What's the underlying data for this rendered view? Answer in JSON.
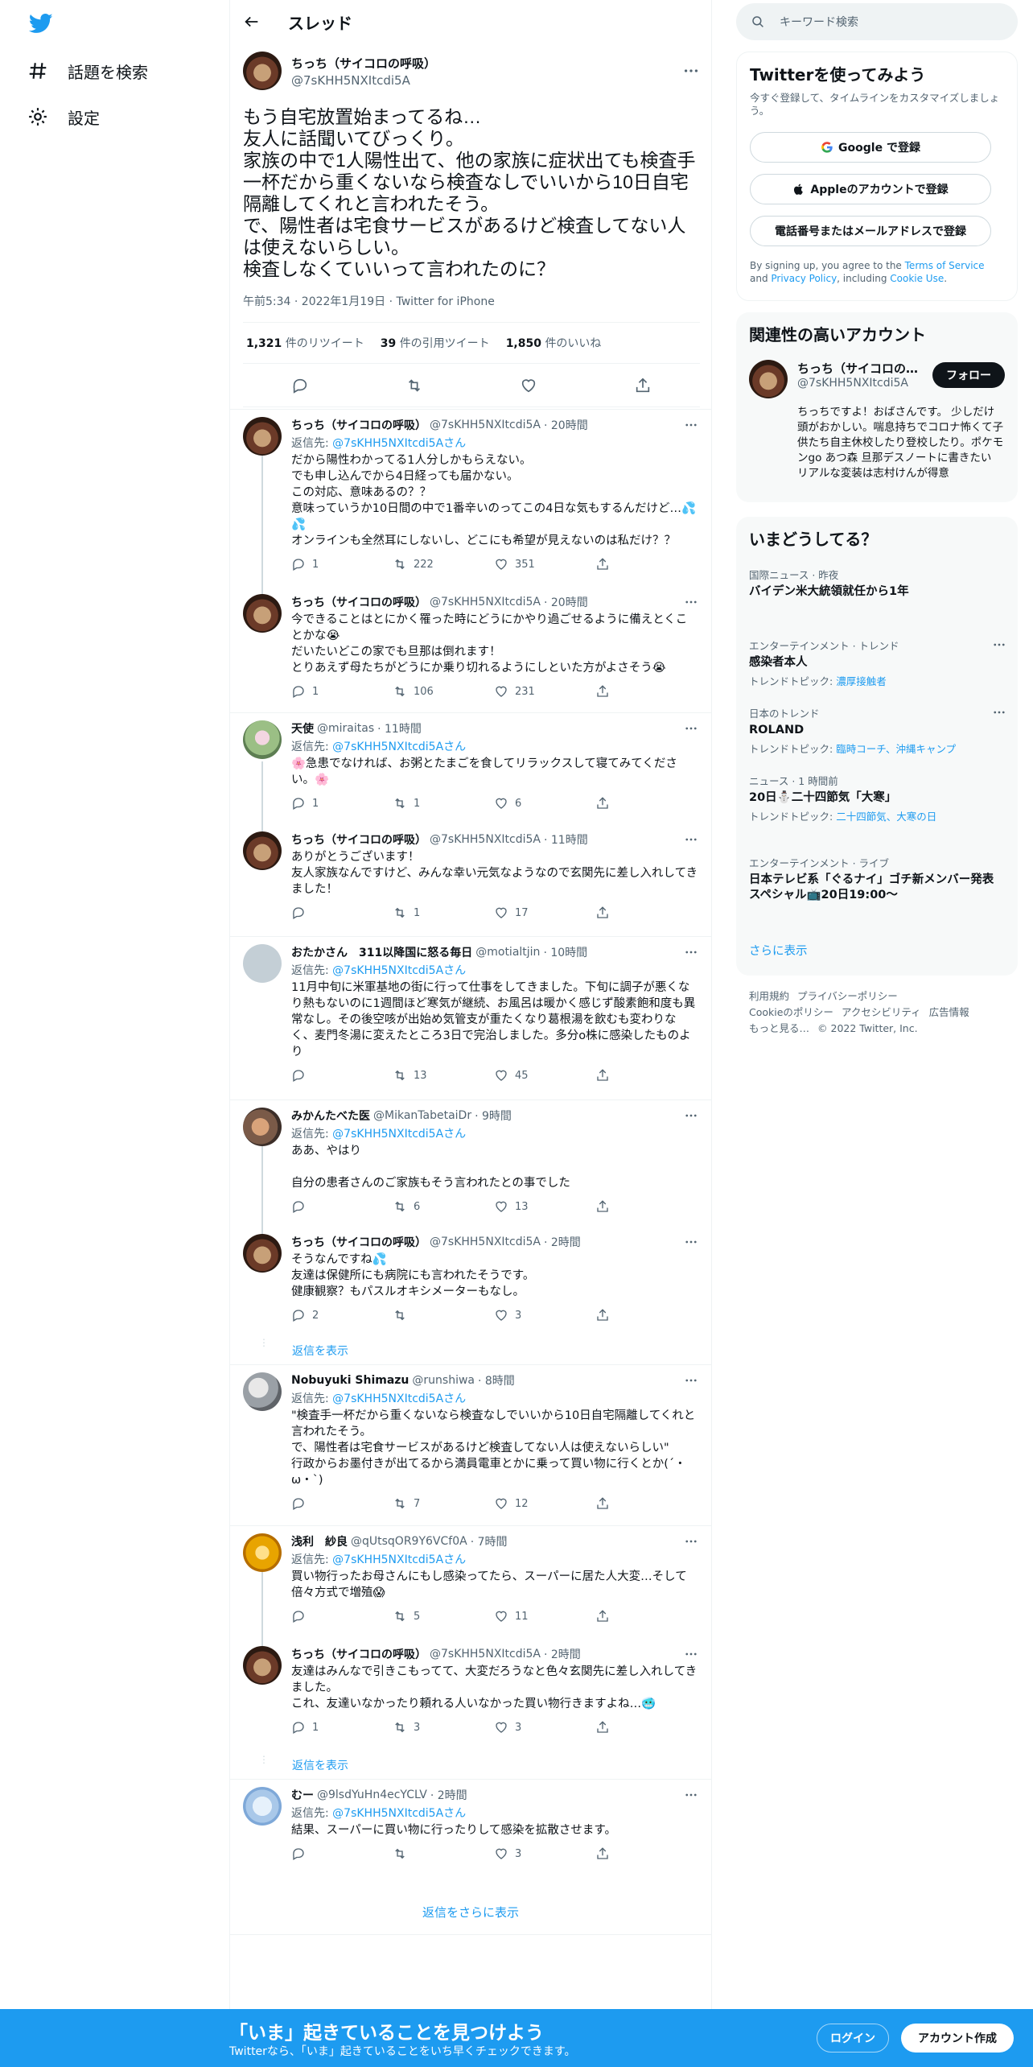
{
  "nav": {
    "explore_label": "話題を検索",
    "settings_label": "設定"
  },
  "header": {
    "title": "スレッド"
  },
  "focal": {
    "name": "ちっち（サイコロの呼吸）",
    "handle": "@7sKHH5NXItcdi5A",
    "text": "もう自宅放置始まってるね…\n友人に話聞いてびっくり。\n家族の中で1人陽性出て、他の家族に症状出ても検査手一杯だから重くないなら検査なしでいいから10日自宅隔離してくれと言われたそう。\nで、陽性者は宅食サービスがあるけど検査してない人は使えないらしい。\n検査しなくていいって言われたのに？",
    "meta": "午前5:34 · 2022年1月19日 · Twitter for iPhone",
    "retweets_count": "1,321",
    "retweets_label": "件のリツイート",
    "quotes_count": "39",
    "quotes_label": "件の引用ツイート",
    "likes_count": "1,850",
    "likes_label": "件のいいね"
  },
  "replies": [
    {
      "name": "ちっち（サイコロの呼吸）",
      "handle": "@7sKHH5NXItcdi5A",
      "time": "· 20時間",
      "reply_to": "@7sKHH5NXItcdi5A",
      "text": "だから陽性わかってる1人分しかもらえない。\nでも申し込んでから4日経っても届かない。\nこの対応、意味あるの？？\n意味っていうか10日間の中で1番辛いのってこの4日な気もするんだけど…💦💦\nオンラインも全然耳にしないし、どこにも希望が見えないのは私だけ？？",
      "replies": "1",
      "retweets": "222",
      "likes": "351"
    },
    {
      "name": "ちっち（サイコロの呼吸）",
      "handle": "@7sKHH5NXItcdi5A",
      "time": "· 20時間",
      "reply_to": "",
      "text": "今できることはとにかく罹った時にどうにかやり過ごせるように備えとくことかな😭\nだいたいどこの家でも旦那は倒れます！\nとりあえず母たちがどうにか乗り切れるようにしといた方がよさそう😭",
      "replies": "1",
      "retweets": "106",
      "likes": "231"
    },
    {
      "name": "天使",
      "handle": "@miraitas",
      "time": "· 11時間",
      "reply_to": "@7sKHH5NXItcdi5A",
      "text": "🌸急患でなければ、お粥とたまごを食してリラックスして寝てみてください。🌸",
      "replies": "1",
      "retweets": "1",
      "likes": "6"
    },
    {
      "name": "ちっち（サイコロの呼吸）",
      "handle": "@7sKHH5NXItcdi5A",
      "time": "· 11時間",
      "reply_to": "",
      "text": "ありがとうございます！\n友人家族なんですけど、みんな幸い元気なようなので玄関先に差し入れしてきました！",
      "replies": "",
      "retweets": "1",
      "likes": "17"
    },
    {
      "name": "おたかさん　311以降国に怒る毎日",
      "handle": "@motialtjin",
      "time": "· 10時間",
      "reply_to": "@7sKHH5NXItcdi5A",
      "text": "11月中旬に米軍基地の街に行って仕事をしてきました。下旬に調子が悪くなり熱もないのに1週間ほど寒気が継続、お風呂は暖かく感じず酸素飽和度も異常なし。その後空咳が出始め気管支が重たくなり葛根湯を飲むも変わりなく、麦門冬湯に変えたところ3日で完治しました。多分o株に感染したものより",
      "replies": "",
      "retweets": "13",
      "likes": "45"
    },
    {
      "name": "みかんたべた医",
      "handle": "@MikanTabetaiDr",
      "time": "· 9時間",
      "reply_to": "@7sKHH5NXItcdi5A",
      "text": "ああ、やはり\n\n自分の患者さんのご家族もそう言われたとの事でした",
      "replies": "",
      "retweets": "6",
      "likes": "13"
    },
    {
      "name": "ちっち（サイコロの呼吸）",
      "handle": "@7sKHH5NXItcdi5A",
      "time": "· 2時間",
      "reply_to": "",
      "text": "そうなんですね💦\n友達は保健所にも病院にも言われたそうです。\n健康観察？もパスルオキシメーターもなし。",
      "replies": "2",
      "retweets": "",
      "likes": "3"
    },
    {
      "name": "Nobuyuki Shimazu",
      "handle": "@runshiwa",
      "time": "· 8時間",
      "reply_to": "@7sKHH5NXItcdi5A",
      "text": "\"検査手一杯だから重くないなら検査なしでいいから10日自宅隔離してくれと言われたそう。\nで、陽性者は宅食サービスがあるけど検査してない人は使えないらしい\"\n行政からお墨付きが出てるから満員電車とかに乗って買い物に行くとか(´・ω・`)",
      "replies": "",
      "retweets": "7",
      "likes": "12"
    },
    {
      "name": "浅利　紗良",
      "handle": "@qUtsqOR9Y6VCf0A",
      "time": "· 7時間",
      "reply_to": "@7sKHH5NXItcdi5A",
      "text": "買い物行ったお母さんにもし感染ってたら、スーパーに居た人大変…そして倍々方式で増殖😱",
      "replies": "",
      "retweets": "5",
      "likes": "11"
    },
    {
      "name": "ちっち（サイコロの呼吸）",
      "handle": "@7sKHH5NXItcdi5A",
      "time": "· 2時間",
      "reply_to": "",
      "text": "友達はみんなで引きこもってて、大変だろうなと色々玄関先に差し入れしてきました。\nこれ、友達いなかったり頼れる人いなかった買い物行きますよね…🥶",
      "replies": "1",
      "retweets": "3",
      "likes": "3"
    },
    {
      "name": "むー",
      "handle": "@9lsdYuHn4ecYCLV",
      "time": "· 2時間",
      "reply_to": "@7sKHH5NXItcdi5A",
      "text": "結果、スーパーに買い物に行ったりして感染を拡散させます。",
      "replies": "",
      "retweets": "",
      "likes": "3"
    }
  ],
  "reply_to_prefix": "返信先: ",
  "reply_to_suffix": "さん",
  "show_replies_label": "返信を表示",
  "more_replies_label": "返信をさらに表示",
  "search": {
    "placeholder": "キーワード検索"
  },
  "signup_card": {
    "title": "Twitterを使ってみよう",
    "subtitle": "今すぐ登録して、タイムラインをカスタマイズしましょう。",
    "google_label": "Google で登録",
    "apple_label": "Appleのアカウントで登録",
    "phone_label": "電話番号またはメールアドレスで登録",
    "legal_prefix": "By signing up, you agree to the ",
    "terms": "Terms of Service",
    "legal_and": " and ",
    "privacy": "Privacy Policy",
    "legal_including": ", including ",
    "cookie": "Cookie Use",
    "legal_end": "."
  },
  "related": {
    "title": "関連性の高いアカウント",
    "name": "ちっち（サイコロの…",
    "handle": "@7sKHH5NXItcdi5A",
    "follow_label": "フォロー",
    "bio": "ちっちですよ！おばさんです。 少しだけ頭がおかしい。喘息持ちでコロナ怖くて子供たち自主休校したり登校したり。ポケモンgo あつ森 旦那デスノートに書きたい リアルな変装は志村けんが得意"
  },
  "trends": {
    "title": "いまどうしてる？",
    "items": [
      {
        "category": "国際ニュース · 昨夜",
        "title": "バイデン米大統領就任から1年",
        "topic_label": "",
        "topic": ""
      },
      {
        "category": "エンターテインメント · トレンド",
        "title": "感染者本人",
        "topic_label": "トレンドトピック: ",
        "topic": "濃厚接触者"
      },
      {
        "category": "日本のトレンド",
        "title": "ROLAND",
        "topic_label": "トレンドトピック: ",
        "topic": "臨時コーチ、沖縄キャンプ"
      },
      {
        "category": "ニュース · 1 時間前",
        "title": "20日⛄二十四節気「大寒」",
        "topic_label": "トレンドトピック: ",
        "topic": "二十四節気、大寒の日"
      },
      {
        "category": "エンターテインメント · ライブ",
        "title": "日本テレビ系「ぐるナイ」ゴチ新メンバー発表スペシャル📺20日19:00〜",
        "topic_label": "",
        "topic": ""
      }
    ],
    "show_more": "さらに表示"
  },
  "footer": {
    "links": [
      "利用規約",
      "プライバシーポリシー",
      "Cookieのポリシー",
      "アクセシビリティ",
      "広告情報",
      "もっと見る…"
    ],
    "copyright": "© 2022 Twitter, Inc."
  },
  "bottom_bar": {
    "title": "「いま」起きていることを見つけよう",
    "subtitle": "Twitterなら、「いま」起きていることをいち早くチェックできます。",
    "login_label": "ログイン",
    "signup_label": "アカウント作成"
  },
  "colors": {
    "brand": "#1d9bf0",
    "text": "#0f1419",
    "muted": "#536471"
  }
}
